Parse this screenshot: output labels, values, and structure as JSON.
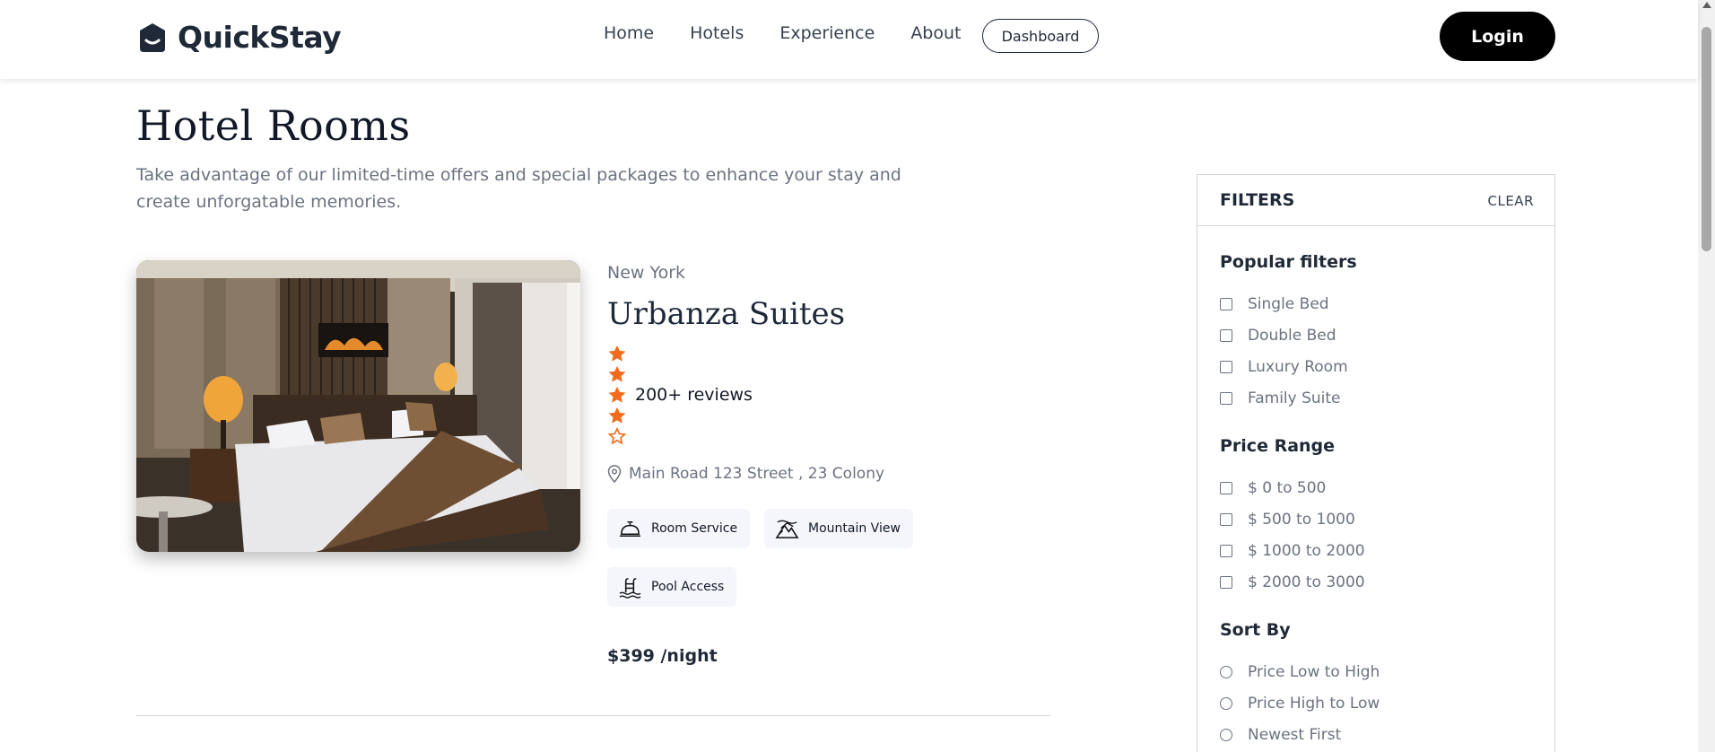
{
  "brand": {
    "name": "QuickStay"
  },
  "nav": {
    "links": [
      "Home",
      "Hotels",
      "Experience",
      "About"
    ],
    "dashboard_label": "Dashboard",
    "login_label": "Login"
  },
  "header": {
    "title": "Hotel Rooms",
    "subtitle": "Take advantage of our limited-time offers and special packages to enhance your stay and create unforgatable memories."
  },
  "hotel": {
    "city": "New York",
    "name": "Urbanza Suites",
    "rating": 4,
    "max_rating": 5,
    "reviews": "200+ reviews",
    "address": "Main Road 123 Street , 23 Colony",
    "amenities": [
      {
        "label": "Room Service",
        "icon": "room-service-bell-icon"
      },
      {
        "label": "Mountain View",
        "icon": "mountain-view-icon"
      },
      {
        "label": "Pool Access",
        "icon": "pool-ladder-icon"
      }
    ],
    "price": "$399 /night"
  },
  "filters": {
    "title": "FILTERS",
    "clear_label": "CLEAR",
    "popular": {
      "title": "Popular filters",
      "options": [
        "Single Bed",
        "Double Bed",
        "Luxury Room",
        "Family Suite"
      ]
    },
    "price_range": {
      "title": "Price Range",
      "options": [
        "$ 0 to 500",
        "$ 500 to 1000",
        "$ 1000 to 2000",
        "$ 2000 to 3000"
      ]
    },
    "sort_by": {
      "title": "Sort By",
      "options": [
        "Price Low to High",
        "Price High to Low",
        "Newest First"
      ]
    }
  },
  "colors": {
    "star": "#f26b1d",
    "accent_dark": "#000000",
    "chip_bg": "#f5f6fb"
  }
}
